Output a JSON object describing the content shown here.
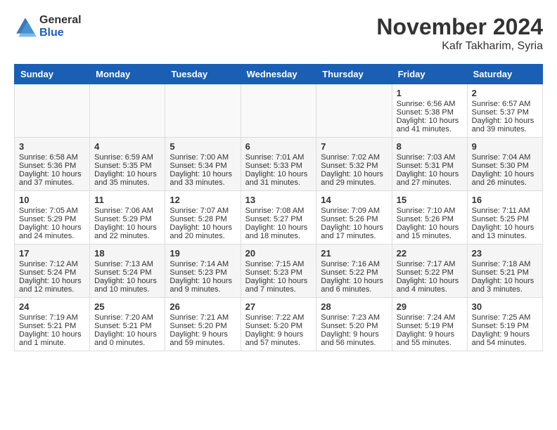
{
  "header": {
    "logo_general": "General",
    "logo_blue": "Blue",
    "month_title": "November 2024",
    "location": "Kafr Takharim, Syria"
  },
  "columns": [
    "Sunday",
    "Monday",
    "Tuesday",
    "Wednesday",
    "Thursday",
    "Friday",
    "Saturday"
  ],
  "weeks": [
    [
      {
        "day": "",
        "lines": []
      },
      {
        "day": "",
        "lines": []
      },
      {
        "day": "",
        "lines": []
      },
      {
        "day": "",
        "lines": []
      },
      {
        "day": "",
        "lines": []
      },
      {
        "day": "1",
        "lines": [
          "Sunrise: 6:56 AM",
          "Sunset: 5:38 PM",
          "Daylight: 10 hours",
          "and 41 minutes."
        ]
      },
      {
        "day": "2",
        "lines": [
          "Sunrise: 6:57 AM",
          "Sunset: 5:37 PM",
          "Daylight: 10 hours",
          "and 39 minutes."
        ]
      }
    ],
    [
      {
        "day": "3",
        "lines": [
          "Sunrise: 6:58 AM",
          "Sunset: 5:36 PM",
          "Daylight: 10 hours",
          "and 37 minutes."
        ]
      },
      {
        "day": "4",
        "lines": [
          "Sunrise: 6:59 AM",
          "Sunset: 5:35 PM",
          "Daylight: 10 hours",
          "and 35 minutes."
        ]
      },
      {
        "day": "5",
        "lines": [
          "Sunrise: 7:00 AM",
          "Sunset: 5:34 PM",
          "Daylight: 10 hours",
          "and 33 minutes."
        ]
      },
      {
        "day": "6",
        "lines": [
          "Sunrise: 7:01 AM",
          "Sunset: 5:33 PM",
          "Daylight: 10 hours",
          "and 31 minutes."
        ]
      },
      {
        "day": "7",
        "lines": [
          "Sunrise: 7:02 AM",
          "Sunset: 5:32 PM",
          "Daylight: 10 hours",
          "and 29 minutes."
        ]
      },
      {
        "day": "8",
        "lines": [
          "Sunrise: 7:03 AM",
          "Sunset: 5:31 PM",
          "Daylight: 10 hours",
          "and 27 minutes."
        ]
      },
      {
        "day": "9",
        "lines": [
          "Sunrise: 7:04 AM",
          "Sunset: 5:30 PM",
          "Daylight: 10 hours",
          "and 26 minutes."
        ]
      }
    ],
    [
      {
        "day": "10",
        "lines": [
          "Sunrise: 7:05 AM",
          "Sunset: 5:29 PM",
          "Daylight: 10 hours",
          "and 24 minutes."
        ]
      },
      {
        "day": "11",
        "lines": [
          "Sunrise: 7:06 AM",
          "Sunset: 5:29 PM",
          "Daylight: 10 hours",
          "and 22 minutes."
        ]
      },
      {
        "day": "12",
        "lines": [
          "Sunrise: 7:07 AM",
          "Sunset: 5:28 PM",
          "Daylight: 10 hours",
          "and 20 minutes."
        ]
      },
      {
        "day": "13",
        "lines": [
          "Sunrise: 7:08 AM",
          "Sunset: 5:27 PM",
          "Daylight: 10 hours",
          "and 18 minutes."
        ]
      },
      {
        "day": "14",
        "lines": [
          "Sunrise: 7:09 AM",
          "Sunset: 5:26 PM",
          "Daylight: 10 hours",
          "and 17 minutes."
        ]
      },
      {
        "day": "15",
        "lines": [
          "Sunrise: 7:10 AM",
          "Sunset: 5:26 PM",
          "Daylight: 10 hours",
          "and 15 minutes."
        ]
      },
      {
        "day": "16",
        "lines": [
          "Sunrise: 7:11 AM",
          "Sunset: 5:25 PM",
          "Daylight: 10 hours",
          "and 13 minutes."
        ]
      }
    ],
    [
      {
        "day": "17",
        "lines": [
          "Sunrise: 7:12 AM",
          "Sunset: 5:24 PM",
          "Daylight: 10 hours",
          "and 12 minutes."
        ]
      },
      {
        "day": "18",
        "lines": [
          "Sunrise: 7:13 AM",
          "Sunset: 5:24 PM",
          "Daylight: 10 hours",
          "and 10 minutes."
        ]
      },
      {
        "day": "19",
        "lines": [
          "Sunrise: 7:14 AM",
          "Sunset: 5:23 PM",
          "Daylight: 10 hours",
          "and 9 minutes."
        ]
      },
      {
        "day": "20",
        "lines": [
          "Sunrise: 7:15 AM",
          "Sunset: 5:23 PM",
          "Daylight: 10 hours",
          "and 7 minutes."
        ]
      },
      {
        "day": "21",
        "lines": [
          "Sunrise: 7:16 AM",
          "Sunset: 5:22 PM",
          "Daylight: 10 hours",
          "and 6 minutes."
        ]
      },
      {
        "day": "22",
        "lines": [
          "Sunrise: 7:17 AM",
          "Sunset: 5:22 PM",
          "Daylight: 10 hours",
          "and 4 minutes."
        ]
      },
      {
        "day": "23",
        "lines": [
          "Sunrise: 7:18 AM",
          "Sunset: 5:21 PM",
          "Daylight: 10 hours",
          "and 3 minutes."
        ]
      }
    ],
    [
      {
        "day": "24",
        "lines": [
          "Sunrise: 7:19 AM",
          "Sunset: 5:21 PM",
          "Daylight: 10 hours",
          "and 1 minute."
        ]
      },
      {
        "day": "25",
        "lines": [
          "Sunrise: 7:20 AM",
          "Sunset: 5:21 PM",
          "Daylight: 10 hours",
          "and 0 minutes."
        ]
      },
      {
        "day": "26",
        "lines": [
          "Sunrise: 7:21 AM",
          "Sunset: 5:20 PM",
          "Daylight: 9 hours",
          "and 59 minutes."
        ]
      },
      {
        "day": "27",
        "lines": [
          "Sunrise: 7:22 AM",
          "Sunset: 5:20 PM",
          "Daylight: 9 hours",
          "and 57 minutes."
        ]
      },
      {
        "day": "28",
        "lines": [
          "Sunrise: 7:23 AM",
          "Sunset: 5:20 PM",
          "Daylight: 9 hours",
          "and 56 minutes."
        ]
      },
      {
        "day": "29",
        "lines": [
          "Sunrise: 7:24 AM",
          "Sunset: 5:19 PM",
          "Daylight: 9 hours",
          "and 55 minutes."
        ]
      },
      {
        "day": "30",
        "lines": [
          "Sunrise: 7:25 AM",
          "Sunset: 5:19 PM",
          "Daylight: 9 hours",
          "and 54 minutes."
        ]
      }
    ]
  ]
}
